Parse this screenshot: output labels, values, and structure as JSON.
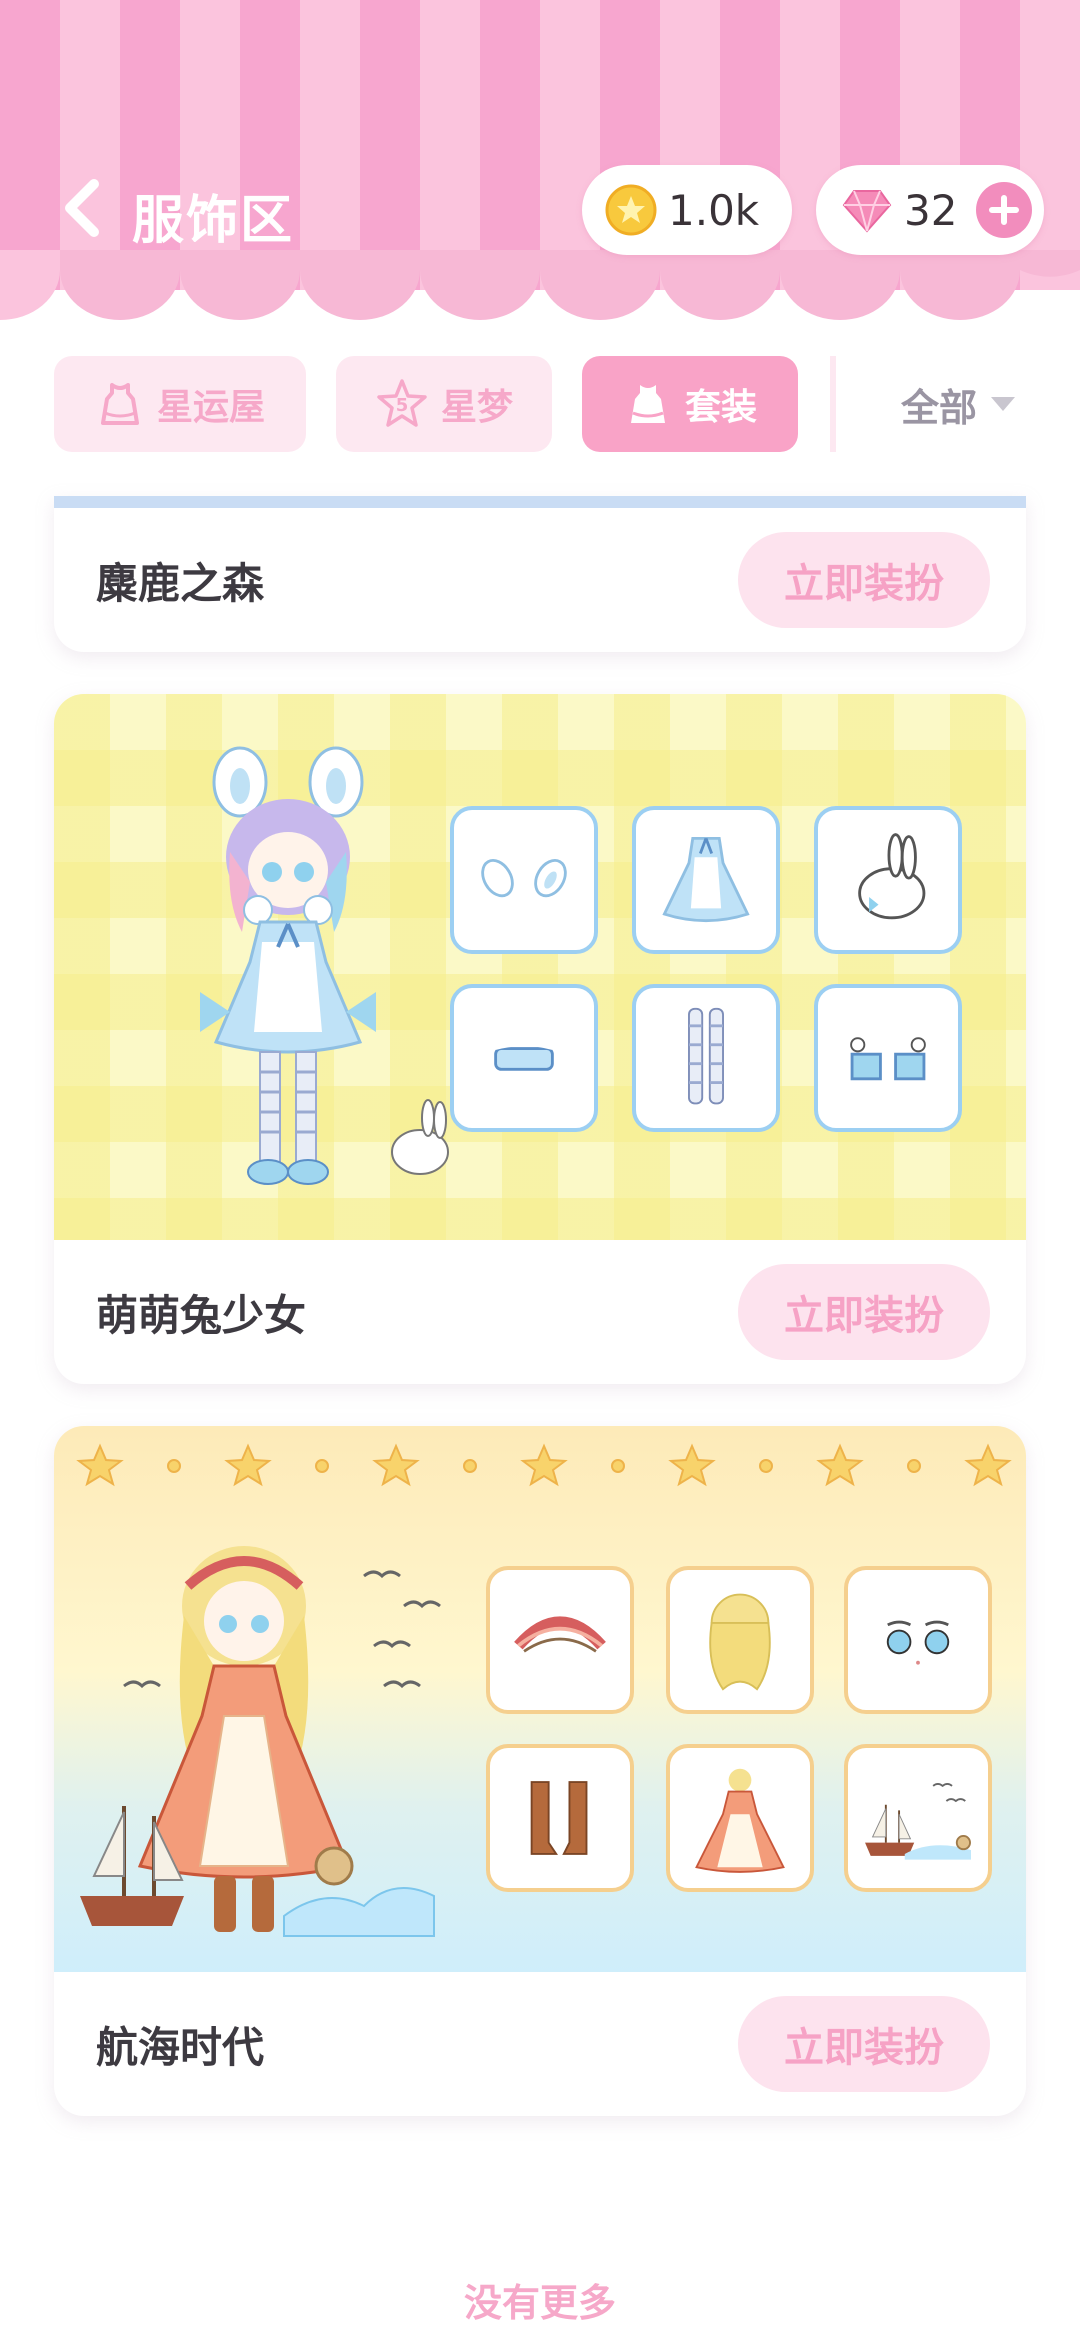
{
  "header": {
    "title": "服饰区",
    "coins": "1.0k",
    "gems": "32"
  },
  "tabs": [
    {
      "label": "星运屋",
      "active": false
    },
    {
      "label": "星梦",
      "badge": "5",
      "active": false
    },
    {
      "label": "套装",
      "active": true
    }
  ],
  "filter": {
    "label": "全部"
  },
  "cards": [
    {
      "name": "麋鹿之森",
      "button": "立即装扮"
    },
    {
      "name": "萌萌兔少女",
      "button": "立即装扮"
    },
    {
      "name": "航海时代",
      "button": "立即装扮"
    }
  ],
  "footer": {
    "no_more": "没有更多"
  },
  "colors": {
    "primary_pink": "#f9a3c7",
    "light_pink": "#fde3ee",
    "button_text": "#f6a2c5"
  }
}
